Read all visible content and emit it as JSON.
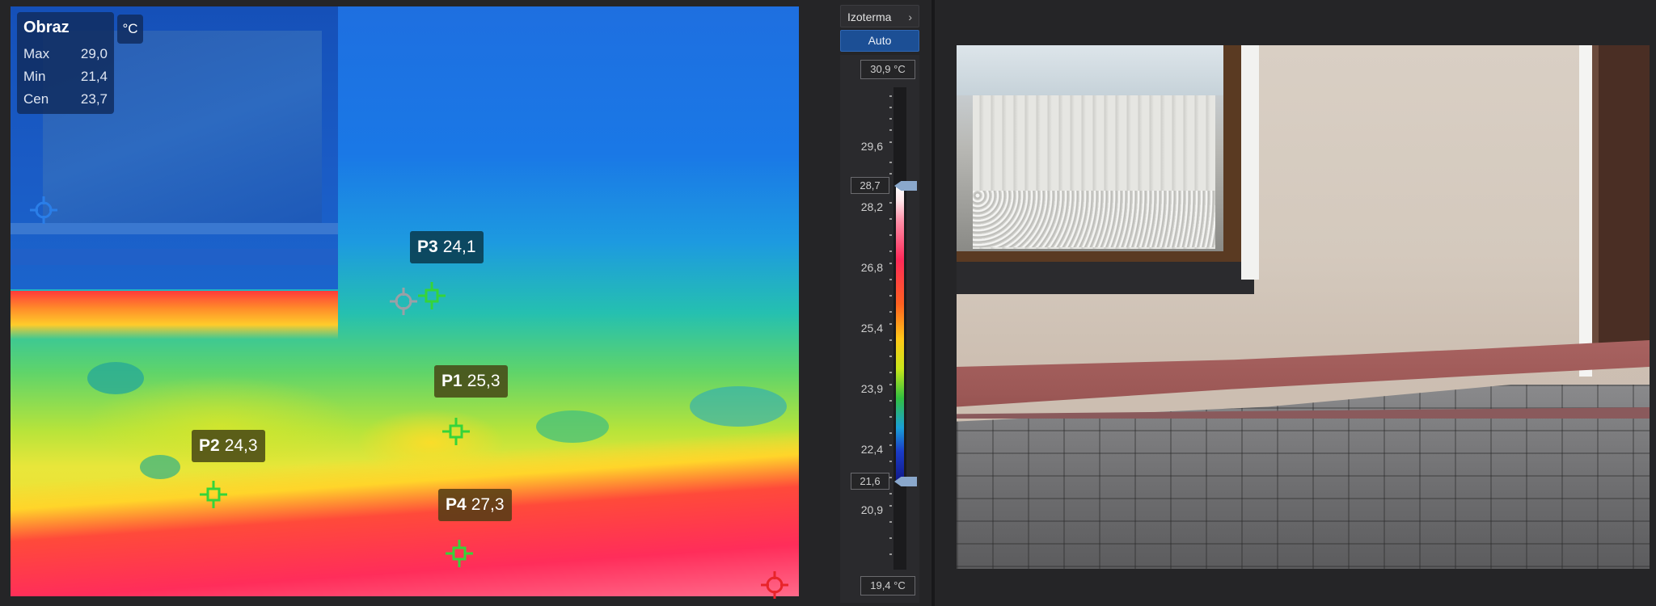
{
  "stats": {
    "title": "Obraz",
    "unit": "°C",
    "rows": [
      {
        "label": "Max",
        "value": "29,0"
      },
      {
        "label": "Min",
        "value": "21,4"
      },
      {
        "label": "Cen",
        "value": "23,7"
      }
    ]
  },
  "markers": {
    "p1": {
      "name": "P1",
      "value": "25,3"
    },
    "p2": {
      "name": "P2",
      "value": "24,3"
    },
    "p3": {
      "name": "P3",
      "value": "24,1"
    },
    "p4": {
      "name": "P4",
      "value": "27,3"
    }
  },
  "panel": {
    "isotherm_label": "Izoterma",
    "isotherm_chevron": "›",
    "auto_label": "Auto",
    "top_value": "30,9 °C",
    "bottom_value": "19,4 °C",
    "upper_handle": "28,7",
    "lower_handle": "21,6",
    "ticks": [
      "29,6",
      "28,2",
      "26,8",
      "25,4",
      "23,9",
      "22,4",
      "20,9"
    ]
  },
  "colors": {
    "marker_green": "#35d43a",
    "marker_blue": "#2a7ee8",
    "marker_red": "#e8242a",
    "marker_grey": "#9aa0a6",
    "accent_blue": "#1c4f95"
  }
}
